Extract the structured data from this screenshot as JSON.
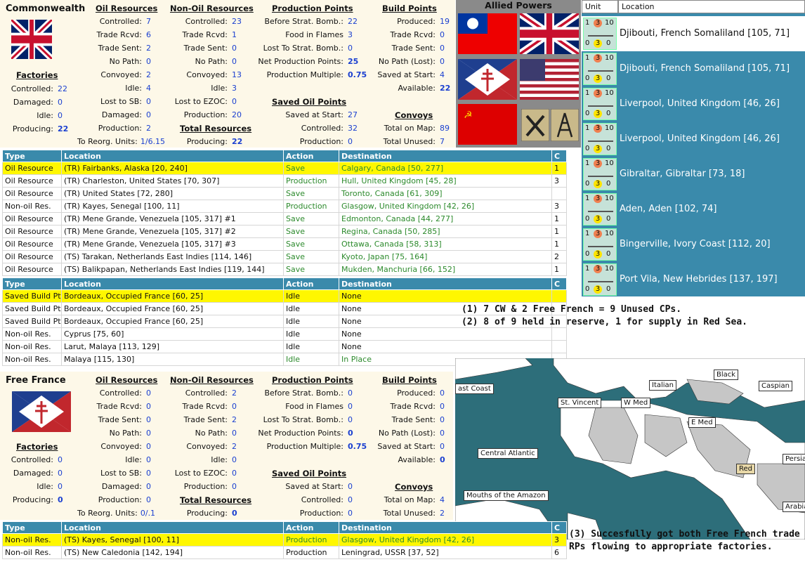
{
  "cw": {
    "name": "Commonwealth",
    "oil": {
      "title": "Oil Resources",
      "rows": [
        [
          "Controlled:",
          "7"
        ],
        [
          "Trade Rcvd:",
          "6"
        ],
        [
          "Trade Sent:",
          "2"
        ],
        [
          "No Path:",
          "0"
        ],
        [
          "Convoyed:",
          "2"
        ],
        [
          "Idle:",
          "4"
        ],
        [
          "Lost to SB:",
          "0"
        ],
        [
          "Damaged:",
          "0"
        ],
        [
          "Production:",
          "2"
        ]
      ]
    },
    "nonoil": {
      "title": "Non-Oil Resources",
      "rows": [
        [
          "Controlled:",
          "23"
        ],
        [
          "Trade Rcvd:",
          "1"
        ],
        [
          "Trade Sent:",
          "0"
        ],
        [
          "No Path:",
          "0"
        ],
        [
          "Convoyed:",
          "13"
        ],
        [
          "Idle:",
          "3"
        ],
        [
          "Lost to EZOC:",
          "0"
        ],
        [
          "Production:",
          "20"
        ]
      ]
    },
    "pp": {
      "title": "Production Points",
      "rows": [
        [
          "Before Strat. Bomb.:",
          "22"
        ],
        [
          "Food in Flames",
          "3"
        ],
        [
          "Lost To Strat. Bomb.:",
          "0"
        ],
        [
          "Net Production Points:",
          "25"
        ],
        [
          "Production Multiple:",
          "0.75"
        ]
      ]
    },
    "bp": {
      "title": "Build Points",
      "rows": [
        [
          "Produced:",
          "19"
        ],
        [
          "Trade Rcvd:",
          "0"
        ],
        [
          "Trade Sent:",
          "0"
        ],
        [
          "No Path (Lost):",
          "0"
        ],
        [
          "Saved at Start:",
          "4"
        ],
        [
          "Available:",
          "22"
        ]
      ]
    },
    "factories": {
      "title": "Factories",
      "rows": [
        [
          "Controlled:",
          "22"
        ],
        [
          "Damaged:",
          "0"
        ],
        [
          "Idle:",
          "0"
        ],
        [
          "Producing:",
          "22"
        ]
      ]
    },
    "saved_oil": {
      "title": "Saved Oil Points",
      "rows": [
        [
          "Saved at Start:",
          "27"
        ],
        [
          "Controlled:",
          "32"
        ],
        [
          "Production:",
          "0"
        ]
      ]
    },
    "convoys": {
      "title": "Convoys",
      "rows": [
        [
          "Total on Map:",
          "89"
        ],
        [
          "Total Unused:",
          "7"
        ]
      ]
    },
    "total": {
      "title": "Total Resources",
      "rows": [
        [
          "Producing:",
          "22"
        ]
      ]
    },
    "reorg": {
      "label": "To Reorg. Units:",
      "value": "1/6.15"
    }
  },
  "ff": {
    "name": "Free France",
    "oil": {
      "title": "Oil Resources",
      "rows": [
        [
          "Controlled:",
          "0"
        ],
        [
          "Trade Rcvd:",
          "0"
        ],
        [
          "Trade Sent:",
          "0"
        ],
        [
          "No Path:",
          "0"
        ],
        [
          "Convoyed:",
          "0"
        ],
        [
          "Idle:",
          "0"
        ],
        [
          "Lost to SB:",
          "0"
        ],
        [
          "Damaged:",
          "0"
        ],
        [
          "Production:",
          "0"
        ]
      ]
    },
    "nonoil": {
      "title": "Non-Oil Resources",
      "rows": [
        [
          "Controlled:",
          "2"
        ],
        [
          "Trade Rcvd:",
          "0"
        ],
        [
          "Trade Sent:",
          "2"
        ],
        [
          "No Path:",
          "0"
        ],
        [
          "Convoyed:",
          "2"
        ],
        [
          "Idle:",
          "0"
        ],
        [
          "Lost to EZOC:",
          "0"
        ],
        [
          "Production:",
          "0"
        ]
      ]
    },
    "pp": {
      "title": "Production Points",
      "rows": [
        [
          "Before Strat. Bomb.:",
          "0"
        ],
        [
          "Food in Flames",
          "0"
        ],
        [
          "Lost To Strat. Bomb.:",
          "0"
        ],
        [
          "Net Production Points:",
          "0"
        ],
        [
          "Production Multiple:",
          "0.75"
        ]
      ]
    },
    "bp": {
      "title": "Build Points",
      "rows": [
        [
          "Produced:",
          "0"
        ],
        [
          "Trade Rcvd:",
          "0"
        ],
        [
          "Trade Sent:",
          "0"
        ],
        [
          "No Path (Lost):",
          "0"
        ],
        [
          "Saved at Start:",
          "0"
        ],
        [
          "Available:",
          "0"
        ]
      ]
    },
    "factories": {
      "title": "Factories",
      "rows": [
        [
          "Controlled:",
          "0"
        ],
        [
          "Damaged:",
          "0"
        ],
        [
          "Idle:",
          "0"
        ],
        [
          "Producing:",
          "0"
        ]
      ]
    },
    "saved_oil": {
      "title": "Saved Oil Points",
      "rows": [
        [
          "Saved at Start:",
          "0"
        ],
        [
          "Controlled:",
          "0"
        ],
        [
          "Production:",
          "0"
        ]
      ]
    },
    "convoys": {
      "title": "Convoys",
      "rows": [
        [
          "Total on Map:",
          "4"
        ],
        [
          "Total Unused:",
          "2"
        ]
      ]
    },
    "total": {
      "title": "Total Resources",
      "rows": [
        [
          "Producing:",
          "0"
        ]
      ]
    },
    "reorg": {
      "label": "To Reorg. Units:",
      "value": "0/.1"
    }
  },
  "table1": {
    "headers": [
      "Type",
      "Location",
      "Action",
      "Destination",
      "C"
    ],
    "rows": [
      [
        "Oil Resource",
        "(TR) Fairbanks, Alaska [20, 240]",
        "Save",
        "Calgary, Canada [50, 277]",
        "1"
      ],
      [
        "Oil Resource",
        "(TR) Charleston, United States [70, 307]",
        "Production",
        "Hull, United Kingdom [45, 28]",
        "3"
      ],
      [
        "Oil Resource",
        "(TR) United States [72, 280]",
        "Save",
        "Toronto, Canada [61, 309]",
        ""
      ],
      [
        "Non-oil Res.",
        "(TR) Kayes, Senegal [100, 11]",
        "Production",
        "Glasgow, United Kingdom [42, 26]",
        "3"
      ],
      [
        "Oil Resource",
        "(TR) Mene Grande, Venezuela [105, 317] #1",
        "Save",
        "Edmonton, Canada [44, 277]",
        "1"
      ],
      [
        "Oil Resource",
        "(TR) Mene Grande, Venezuela [105, 317] #2",
        "Save",
        "Regina, Canada [50, 285]",
        "1"
      ],
      [
        "Oil Resource",
        "(TR) Mene Grande, Venezuela [105, 317] #3",
        "Save",
        "Ottawa, Canada [58, 313]",
        "1"
      ],
      [
        "Oil Resource",
        "(TS) Tarakan, Netherlands East Indies [114, 146]",
        "Save",
        "Kyoto, Japan [75, 164]",
        "2"
      ],
      [
        "Oil Resource",
        "(TS) Balikpapan, Netherlands East Indies [119, 144]",
        "Save",
        "Mukden, Manchuria [66, 152]",
        "1"
      ]
    ]
  },
  "table2": {
    "headers": [
      "Type",
      "Location",
      "Action",
      "Destination",
      "C"
    ],
    "rows": [
      [
        "Saved Build Pt",
        "Bordeaux, Occupied France [60, 25]",
        "Idle",
        "None",
        ""
      ],
      [
        "Saved Build Pt",
        "Bordeaux, Occupied France [60, 25]",
        "Idle",
        "None",
        ""
      ],
      [
        "Saved Build Pt",
        "Bordeaux, Occupied France [60, 25]",
        "Idle",
        "None",
        ""
      ],
      [
        "Non-oil Res.",
        "Cyprus [75, 60]",
        "Idle",
        "None",
        ""
      ],
      [
        "Non-oil Res.",
        "Larut, Malaya [113, 129]",
        "Idle",
        "None",
        ""
      ],
      [
        "Non-oil Res.",
        "Malaya [115, 130]",
        "Idle",
        "In Place",
        ""
      ]
    ]
  },
  "table3": {
    "headers": [
      "Type",
      "Location",
      "Action",
      "Destination",
      "C"
    ],
    "rows": [
      [
        "Non-oil Res.",
        "(TS) Kayes, Senegal [100, 11]",
        "Production",
        "Glasgow, United Kingdom [42, 26]",
        "3"
      ],
      [
        "Non-oil Res.",
        "(TS) New Caledonia [142, 194]",
        "Production",
        "Leningrad, USSR [37, 52]",
        "6"
      ]
    ]
  },
  "allied": {
    "title": "Allied Powers"
  },
  "units": {
    "headers": [
      "Unit",
      "Location"
    ],
    "counter": [
      "1",
      "3",
      "10",
      "0",
      "3",
      "0"
    ],
    "rows": [
      "Djibouti, French Somaliland [105, 71]",
      "Djibouti, French Somaliland [105, 71]",
      "Liverpool, United Kingdom [46, 26]",
      "Liverpool, United Kingdom [46, 26]",
      "Gibraltar, Gibraltar [73, 18]",
      "Aden, Aden [102, 74]",
      "Bingerville, Ivory Coast [112, 20]",
      "Port Vila, New Hebrides [137, 197]"
    ]
  },
  "notes": {
    "n1": "(1) 7 CW & 2 Free French = 9 Unused CPs.",
    "n2": "(2)  8 of 9 held in reserve, 1 for supply in Red Sea.",
    "n3a": "(3) Succesfully got both Free French trade",
    "n3b": "RPs flowing to appropriate factories."
  },
  "map": {
    "labels": [
      "ast Coast",
      "St. Vincent",
      "W Med",
      "Italian",
      "Black",
      "Caspian",
      "E Med",
      "Central Atlantic",
      "Red",
      "Persia",
      "Mouths of the Amazon",
      "Arabia"
    ]
  }
}
